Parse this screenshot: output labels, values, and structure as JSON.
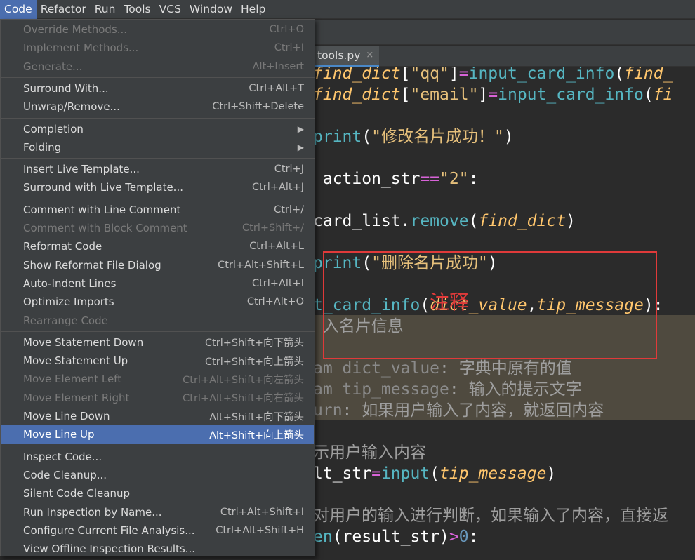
{
  "menubar": {
    "items": [
      {
        "label": "Code",
        "active": true
      },
      {
        "label": "Refactor"
      },
      {
        "label": "Run"
      },
      {
        "label": "Tools"
      },
      {
        "label": "VCS"
      },
      {
        "label": "Window"
      },
      {
        "label": "Help"
      }
    ]
  },
  "editor": {
    "tab": {
      "label": "tools.py",
      "close": "×"
    },
    "annotation": "注释",
    "lines": [
      [
        {
          "t": "find_dict",
          "c": "c-param"
        },
        {
          "t": "[",
          "c": "c-white"
        },
        {
          "t": "\"qq\"",
          "c": "c-strb"
        },
        {
          "t": "]",
          "c": "c-white"
        },
        {
          "t": "=",
          "c": "c-magenta"
        },
        {
          "t": "input_card_info",
          "c": "c-cyan"
        },
        {
          "t": "(",
          "c": "c-white"
        },
        {
          "t": "find_",
          "c": "c-param"
        }
      ],
      [
        {
          "t": "find_dict",
          "c": "c-param"
        },
        {
          "t": "[",
          "c": "c-white"
        },
        {
          "t": "\"email\"",
          "c": "c-strb"
        },
        {
          "t": "]",
          "c": "c-white"
        },
        {
          "t": "=",
          "c": "c-magenta"
        },
        {
          "t": "input_card_info",
          "c": "c-cyan"
        },
        {
          "t": "(",
          "c": "c-white"
        },
        {
          "t": "fi",
          "c": "c-param"
        }
      ],
      [],
      [
        {
          "t": "print",
          "c": "c-cyan"
        },
        {
          "t": "(",
          "c": "c-white"
        },
        {
          "t": "\"修改名片成功！\"",
          "c": "c-strb"
        },
        {
          "t": ")",
          "c": "c-white"
        }
      ],
      [],
      [
        {
          "t": " action_str",
          "c": "c-white"
        },
        {
          "t": "==",
          "c": "c-magenta"
        },
        {
          "t": "\"2\"",
          "c": "c-strb"
        },
        {
          "t": ":",
          "c": "c-white"
        }
      ],
      [],
      [
        {
          "t": "card_list",
          "c": "c-white"
        },
        {
          "t": ".",
          "c": "c-white"
        },
        {
          "t": "remove",
          "c": "c-cyan"
        },
        {
          "t": "(",
          "c": "c-white"
        },
        {
          "t": "find_dict",
          "c": "c-param"
        },
        {
          "t": ")",
          "c": "c-white"
        }
      ],
      [],
      [
        {
          "t": "print",
          "c": "c-cyan"
        },
        {
          "t": "(",
          "c": "c-white"
        },
        {
          "t": "\"删除名片成功\"",
          "c": "c-strb"
        },
        {
          "t": ")",
          "c": "c-white"
        }
      ],
      [],
      [
        {
          "t": "t_card_info",
          "c": "c-cyan"
        },
        {
          "t": "(",
          "c": "c-white"
        },
        {
          "t": "dict_value",
          "c": "c-param"
        },
        {
          "t": ",",
          "c": "c-white"
        },
        {
          "t": "tip_message",
          "c": "c-param"
        },
        {
          "t": "):",
          "c": "c-white"
        }
      ],
      [
        {
          "t": " 入名片信息",
          "c": "c-doc-text"
        }
      ],
      [],
      [
        {
          "t": "am dict_value",
          "c": "c-doc-tag"
        },
        {
          "t": ": 字典中原有的值",
          "c": "c-doc-text"
        }
      ],
      [
        {
          "t": "am tip_message",
          "c": "c-doc-tag"
        },
        {
          "t": ": 输入的提示文字",
          "c": "c-doc-text"
        }
      ],
      [
        {
          "t": "urn",
          "c": "c-doc-tag"
        },
        {
          "t": ": 如果用户输入了内容，就返回内容",
          "c": "c-doc-text"
        }
      ],
      [],
      [
        {
          "t": "示用户输入内容",
          "c": "c-doc-text"
        }
      ],
      [
        {
          "t": "lt_str",
          "c": "c-white"
        },
        {
          "t": "=",
          "c": "c-magenta"
        },
        {
          "t": "input",
          "c": "c-cyan"
        },
        {
          "t": "(",
          "c": "c-white"
        },
        {
          "t": "tip_message",
          "c": "c-param"
        },
        {
          "t": ")",
          "c": "c-white"
        }
      ],
      [],
      [
        {
          "t": "对用户的输入进行判断，如果输入了内容，直接返",
          "c": "c-doc-text"
        }
      ],
      [
        {
          "t": "en",
          "c": "c-cyan"
        },
        {
          "t": "(result_str)",
          "c": "c-white"
        },
        {
          "t": ">",
          "c": "c-magenta"
        },
        {
          "t": "0",
          "c": "c-num"
        },
        {
          "t": ":",
          "c": "c-white"
        }
      ]
    ]
  },
  "code_menu": {
    "items": [
      {
        "label": "Override Methods...",
        "shortcut": "Ctrl+O",
        "disabled": true
      },
      {
        "label": "Implement Methods...",
        "shortcut": "Ctrl+I",
        "disabled": true
      },
      {
        "label": "Generate...",
        "shortcut": "Alt+Insert",
        "disabled": true
      },
      {
        "sep": true
      },
      {
        "label": "Surround With...",
        "shortcut": "Ctrl+Alt+T"
      },
      {
        "label": "Unwrap/Remove...",
        "shortcut": "Ctrl+Shift+Delete"
      },
      {
        "sep": true
      },
      {
        "label": "Completion",
        "submenu": true
      },
      {
        "label": "Folding",
        "submenu": true
      },
      {
        "sep": true
      },
      {
        "label": "Insert Live Template...",
        "shortcut": "Ctrl+J"
      },
      {
        "label": "Surround with Live Template...",
        "shortcut": "Ctrl+Alt+J"
      },
      {
        "sep": true
      },
      {
        "label": "Comment with Line Comment",
        "shortcut": "Ctrl+/"
      },
      {
        "label": "Comment with Block Comment",
        "shortcut": "Ctrl+Shift+/",
        "disabled": true
      },
      {
        "label": "Reformat Code",
        "shortcut": "Ctrl+Alt+L"
      },
      {
        "label": "Show Reformat File Dialog",
        "shortcut": "Ctrl+Alt+Shift+L"
      },
      {
        "label": "Auto-Indent Lines",
        "shortcut": "Ctrl+Alt+I"
      },
      {
        "label": "Optimize Imports",
        "shortcut": "Ctrl+Alt+O"
      },
      {
        "label": "Rearrange Code",
        "disabled": true
      },
      {
        "sep": true
      },
      {
        "label": "Move Statement Down",
        "shortcut": "Ctrl+Shift+向下箭头"
      },
      {
        "label": "Move Statement Up",
        "shortcut": "Ctrl+Shift+向上箭头"
      },
      {
        "label": "Move Element Left",
        "shortcut": "Ctrl+Alt+Shift+向左箭头",
        "disabled": true
      },
      {
        "label": "Move Element Right",
        "shortcut": "Ctrl+Alt+Shift+向右箭头",
        "disabled": true
      },
      {
        "label": "Move Line Down",
        "shortcut": "Alt+Shift+向下箭头"
      },
      {
        "label": "Move Line Up",
        "shortcut": "Alt+Shift+向上箭头",
        "selected": true
      },
      {
        "sep": true
      },
      {
        "label": "Inspect Code..."
      },
      {
        "label": "Code Cleanup..."
      },
      {
        "label": "Silent Code Cleanup"
      },
      {
        "label": "Run Inspection by Name...",
        "shortcut": "Ctrl+Alt+Shift+I"
      },
      {
        "label": "Configure Current File Analysis...",
        "shortcut": "Ctrl+Alt+Shift+H"
      },
      {
        "label": "View Offline Inspection Results..."
      }
    ]
  }
}
